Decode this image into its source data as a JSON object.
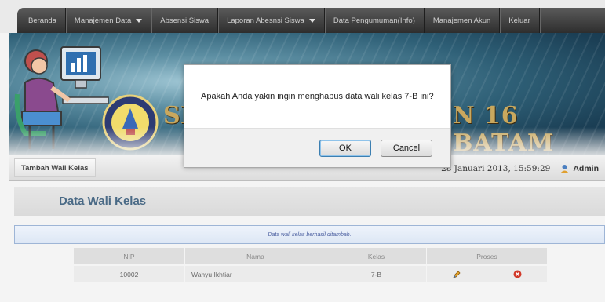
{
  "nav": {
    "items": [
      {
        "label": "Beranda",
        "dropdown": false
      },
      {
        "label": "Manajemen Data",
        "dropdown": true
      },
      {
        "label": "Absensi Siswa",
        "dropdown": false
      },
      {
        "label": "Laporan Abesnsi Siswa",
        "dropdown": true
      },
      {
        "label": "Data Pengumuman(Info)",
        "dropdown": false
      },
      {
        "label": "Manajemen Akun",
        "dropdown": false
      },
      {
        "label": "Keluar",
        "dropdown": false
      }
    ]
  },
  "banner": {
    "title_left": "SI",
    "title_right": "N 16 BATAM"
  },
  "toolbar": {
    "add_button": "Tambah Wali Kelas",
    "datetime": "28 Januari 2013, 15:59:29",
    "user": "Admin"
  },
  "page": {
    "title": "Data Wali Kelas",
    "alert": "Data wali kelas berhasil ditambah."
  },
  "table": {
    "headers": [
      "NIP",
      "Nama",
      "Kelas",
      "Proses"
    ],
    "rows": [
      {
        "nip": "10002",
        "nama": "Wahyu Ikhtiar",
        "kelas": "7-B"
      }
    ]
  },
  "dialog": {
    "message": "Apakah Anda yakin ingin menghapus data wali kelas 7-B ini?",
    "ok": "OK",
    "cancel": "Cancel"
  },
  "colors": {
    "accent_title": "#4a6a86",
    "alert_text": "#4b5fa0",
    "banner_text": "#c9a85e"
  }
}
